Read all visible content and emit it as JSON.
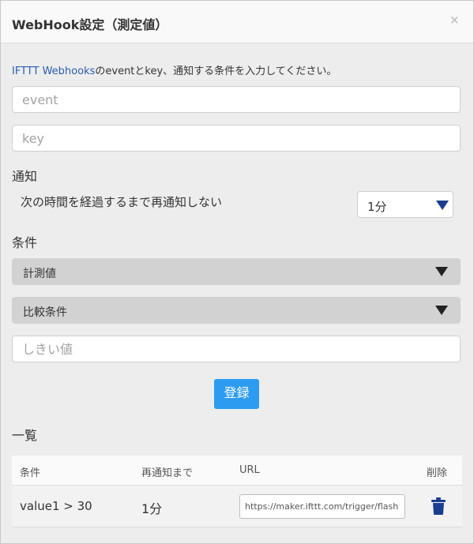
{
  "dialog": {
    "title": "WebHook設定（測定値）",
    "close_glyph": "×"
  },
  "description": {
    "link_text": "IFTTT Webhooks",
    "rest_text": "のeventとkey、通知する条件を入力してください。"
  },
  "inputs": {
    "event_placeholder": "event",
    "key_placeholder": "key",
    "threshold_placeholder": "しきい値"
  },
  "notify": {
    "section_label": "通知",
    "description": "次の時間を経過するまで再通知しない",
    "interval_value": "1分"
  },
  "condition": {
    "section_label": "条件",
    "measure_select_value": "計測値",
    "compare_select_value": "比較条件"
  },
  "register_button_label": "登録",
  "list": {
    "section_label": "一覧",
    "headers": {
      "condition": "条件",
      "renotify": "再通知まで",
      "url": "URL",
      "delete": "削除"
    },
    "rows": [
      {
        "condition": "value1 > 30",
        "renotify": "1分",
        "url": "https://maker.ifttt.com/trigger/flash"
      }
    ]
  },
  "icons": {
    "close": "close-icon",
    "dropdown": "chevron-down-icon",
    "delete": "trash-icon"
  },
  "colors": {
    "accent": "#2d9cf0",
    "link": "#2a5db0",
    "trash": "#1a3d8f"
  }
}
